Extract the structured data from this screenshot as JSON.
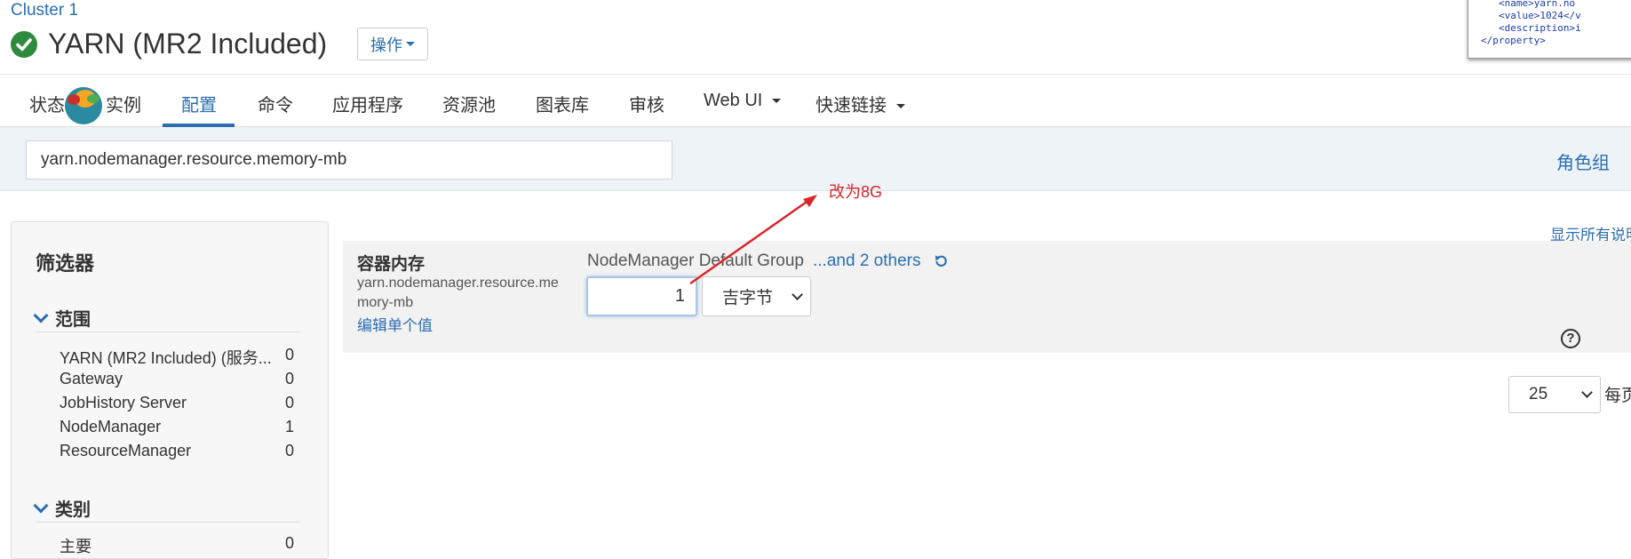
{
  "header": {
    "cluster_link": "Cluster 1",
    "service_title": "YARN (MR2 Included)",
    "actions_label": "操作"
  },
  "code_snippet": {
    "lines": [
      "<name>yarn.no",
      "<value>1024</v",
      "<description>i",
      "</property>"
    ]
  },
  "tabs": [
    {
      "label": "状态",
      "active": false
    },
    {
      "label": "实例",
      "active": false
    },
    {
      "label": "配置",
      "active": true
    },
    {
      "label": "命令",
      "active": false
    },
    {
      "label": "应用程序",
      "active": false
    },
    {
      "label": "资源池",
      "active": false
    },
    {
      "label": "图表库",
      "active": false
    },
    {
      "label": "审核",
      "active": false
    },
    {
      "label": "Web UI",
      "active": false
    },
    {
      "label": "快速链接",
      "active": false
    }
  ],
  "search": {
    "value": "yarn.nodemanager.resource.memory-mb"
  },
  "role_group_link": "角色组",
  "filters": {
    "title": "筛选器",
    "scope": {
      "label": "范围",
      "items": [
        {
          "name": "YARN (MR2 Included) (服务...",
          "count": "0"
        },
        {
          "name": "Gateway",
          "count": "0"
        },
        {
          "name": "JobHistory Server",
          "count": "0"
        },
        {
          "name": "NodeManager",
          "count": "1"
        },
        {
          "name": "ResourceManager",
          "count": "0"
        }
      ]
    },
    "category": {
      "label": "类别",
      "items": [
        {
          "name": "主要",
          "count": "0"
        }
      ]
    }
  },
  "config": {
    "title": "容器内存",
    "key": "yarn.nodemanager.resource.memory-mb",
    "edit_single": "编辑单个值",
    "group_label": "NodeManager Default Group",
    "others_link": "...and 2 others",
    "value": "1",
    "unit": "吉字节",
    "show_all_link": "显示所有说明"
  },
  "pagination": {
    "page_size": "25",
    "per_page_label": "每页"
  },
  "annotation": {
    "text": "改为8G"
  },
  "colors": {
    "accent": "#2a6eb0",
    "status_ok": "#2e8b3d",
    "annotation": "#d9262b"
  }
}
